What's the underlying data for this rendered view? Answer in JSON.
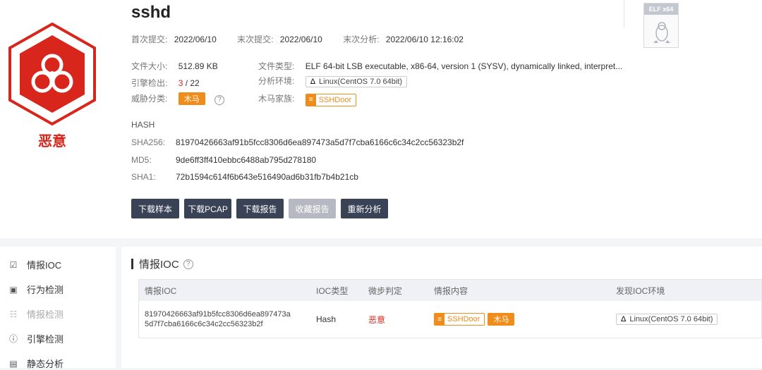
{
  "file": {
    "name": "sshd",
    "verdict": "恶意",
    "first_submit_label": "首次提交:",
    "first_submit": "2022/06/10",
    "last_submit_label": "末次提交:",
    "last_submit": "2022/06/10",
    "last_analysis_label": "末次分析:",
    "last_analysis": "2022/06/10 12:16:02",
    "size_label": "文件大小:",
    "size": "512.89 KB",
    "type_label": "文件类型:",
    "type": "ELF 64-bit LSB executable, x86-64, version 1 (SYSV), dynamically linked, interpret...",
    "engines_label": "引擎检出:",
    "engines_hit": "3",
    "engines_total": " / 22",
    "env_label": "分析环境:",
    "env": "Linux(CentOS 7.0 64bit)",
    "threat_label": "威胁分类:",
    "threat": "木马",
    "family_label": "木马家族:",
    "family": "SSHDoor",
    "elf_badge": "ELF x64"
  },
  "hash": {
    "title": "HASH",
    "sha256_label": "SHA256:",
    "sha256": "81970426663af91b5fcc8306d6ea897473a5d7f7cba6166c6c34c2cc56323b2f",
    "md5_label": "MD5:",
    "md5": "9de6ff3ff410ebbc6488ab795d278180",
    "sha1_label": "SHA1:",
    "sha1": "72b1594c614f6b643e516490ad6b31fb7b4b21cb"
  },
  "buttons": {
    "download_sample": "下载样本",
    "download_pcap": "下载PCAP",
    "download_report": "下载报告",
    "fav_report": "收藏报告",
    "reanalyze": "重新分析"
  },
  "nav": [
    {
      "label": "情报IOC",
      "icon": "check-square-icon"
    },
    {
      "label": "行为检测",
      "icon": "monitor-icon"
    },
    {
      "label": "情报检测",
      "icon": "grid-icon"
    },
    {
      "label": "引擎检测",
      "icon": "help-circle-icon"
    },
    {
      "label": "静态分析",
      "icon": "list-icon"
    }
  ],
  "ioc": {
    "section_title": "情报IOC",
    "columns": [
      "情报IOC",
      "IOC类型",
      "微步判定",
      "情报内容",
      "发现IOC环境"
    ],
    "row": {
      "ioc_line1": "81970426663af91b5fcc8306d6ea897473a",
      "ioc_line2": "5d7f7cba6166c6c34c2cc56323b2f",
      "type": "Hash",
      "verdict": "恶意",
      "family": "SSHDoor",
      "threat": "木马",
      "env": "Linux(CentOS 7.0 64bit)"
    }
  },
  "colors": {
    "malicious_red": "#d9261c",
    "tag_orange": "#f08c1a",
    "button_dark": "#3a4256",
    "button_disabled": "#b6b9c2"
  }
}
